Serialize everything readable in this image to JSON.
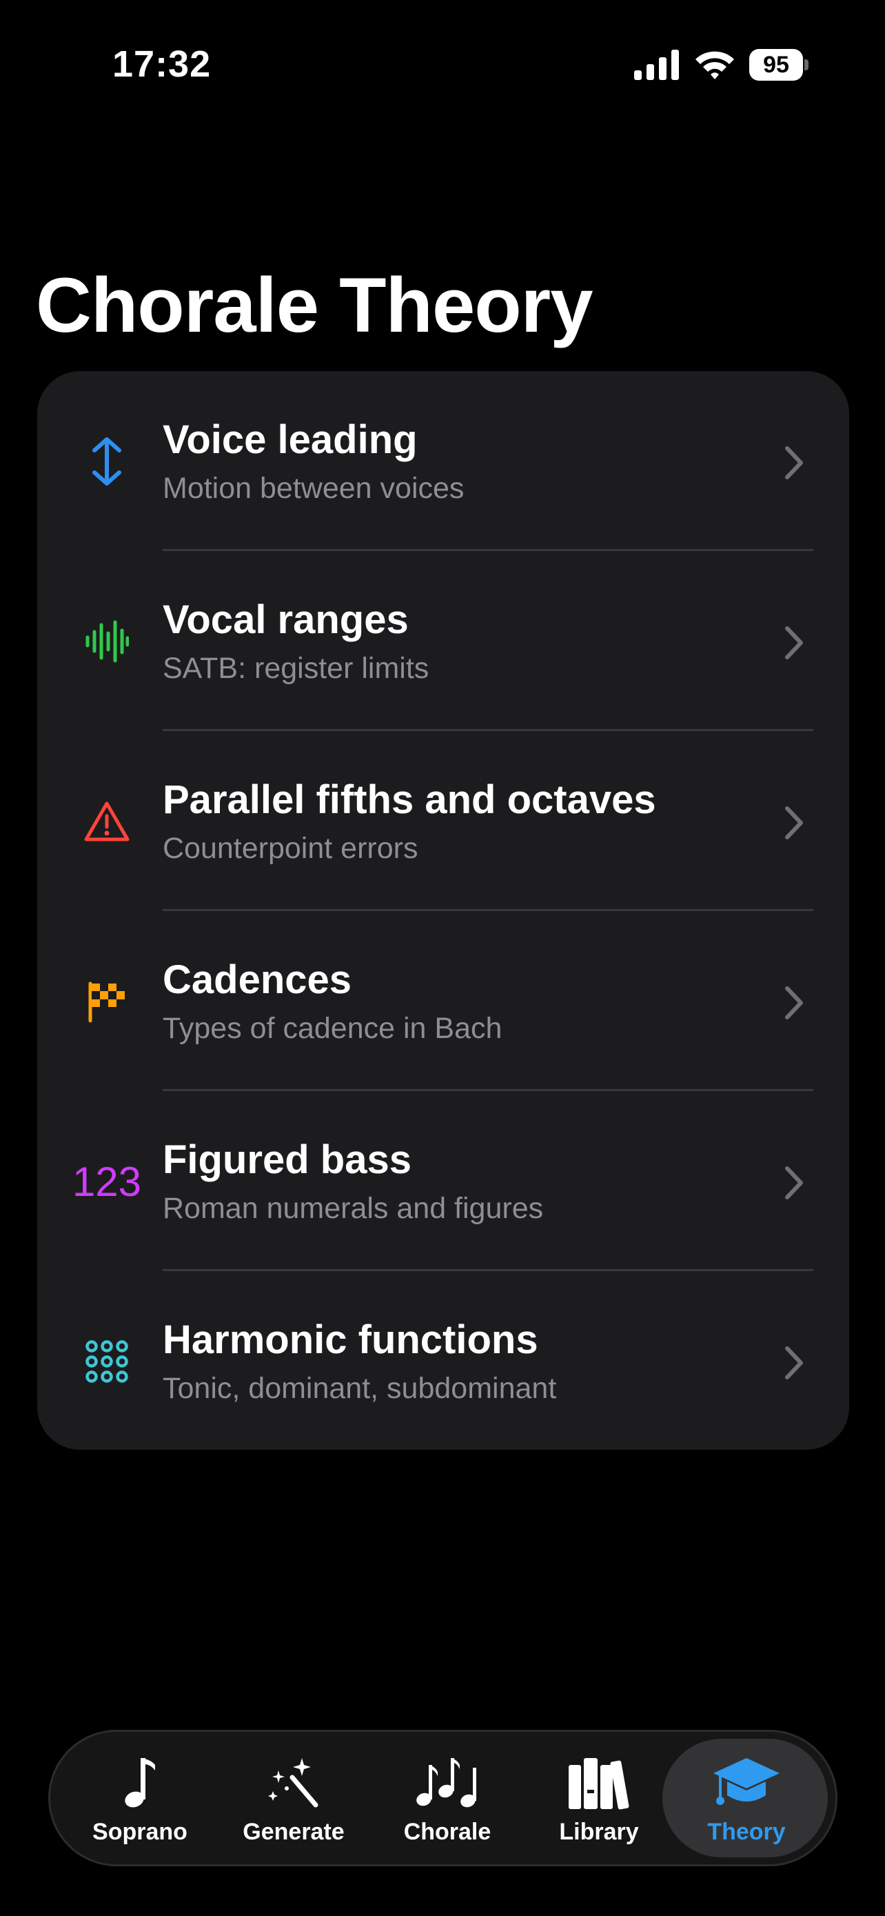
{
  "status_bar": {
    "time": "17:32",
    "battery": "95",
    "icons": [
      "signal-icon",
      "wifi-icon",
      "battery-icon"
    ]
  },
  "page": {
    "title": "Chorale Theory"
  },
  "topics": [
    {
      "title": "Voice leading",
      "subtitle": "Motion between voices",
      "icon": "arrow-up-down-icon",
      "color": "#2f8ff0"
    },
    {
      "title": "Vocal ranges",
      "subtitle": "SATB: register limits",
      "icon": "waveform-icon",
      "color": "#30c84b"
    },
    {
      "title": "Parallel fifths and octaves",
      "subtitle": "Counterpoint errors",
      "icon": "warning-triangle-icon",
      "color": "#ff453a"
    },
    {
      "title": "Cadences",
      "subtitle": "Types of cadence in Bach",
      "icon": "checkered-flag-icon",
      "color": "#ff9f0a"
    },
    {
      "title": "Figured bass",
      "subtitle": "Roman numerals and figures",
      "icon": "numbers-icon",
      "icon_text": "123",
      "color": "#d13bff"
    },
    {
      "title": "Harmonic functions",
      "subtitle": "Tonic, dominant, subdominant",
      "icon": "circle-grid-icon",
      "color": "#3fc6d6"
    }
  ],
  "tab_bar": {
    "tabs": [
      {
        "label": "Soprano",
        "icon": "music-note-icon",
        "active": false
      },
      {
        "label": "Generate",
        "icon": "magic-wand-icon",
        "active": false
      },
      {
        "label": "Chorale",
        "icon": "music-notes-icon",
        "active": false
      },
      {
        "label": "Library",
        "icon": "books-icon",
        "active": false
      },
      {
        "label": "Theory",
        "icon": "graduation-cap-icon",
        "active": true
      }
    ],
    "active_color": "#2f9bf0"
  }
}
